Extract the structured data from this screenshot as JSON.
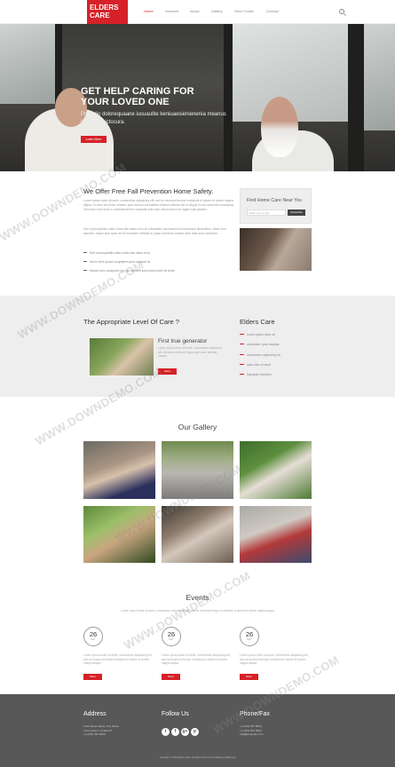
{
  "brand": {
    "line1": "ELDERS",
    "line2": "CARE"
  },
  "nav": {
    "items": [
      "Home",
      "Services",
      "About",
      "Gallery",
      "Short Codes",
      "Contact"
    ],
    "active_index": 0
  },
  "hero": {
    "title_line1": "GET HELP CARING FOR",
    "title_line2": "YOUR LOVED ONE",
    "subtitle": "Pro odio dolorequaane iusuaulite keniuaesienienenia meanus tincidunt pictocura.",
    "button": "Learn More"
  },
  "prevention": {
    "title": "We Offer Free Fall Prevention Home Safety.",
    "para1": "Lorem ipsum dolor sit amet, consectetur adipiscing elit, sed do eiusmod tempor incididunt ut labore et dolore magna aliqua. Ut enim ad minim veniam, quis nostrud exercitation ullamco laboris nisi ut aliquip ex ea commodo consequat. Duis aute irure dolor in reprehenderit in voluptate velit esse cillum dolore eu fugiat nulla pariatur.",
    "para2": "Sed ut perspiciatis unde omnis iste natus error sit voluptatem accusantium doloremque laudantium, totam rem aperiam, eaque ipsa quae ab illo inventore veritatis et quasi architecto beatae vitae dicta sunt explicabo.",
    "list": [
      "Sed ut perspiciatis unde omnis iste natus error",
      "Nemo enim ipsam voluptatem quia voluptas sit",
      "Neque porro quisquam est, qui dolorem ipsum quia dolor sit amet"
    ]
  },
  "form": {
    "title": "Find Home Care Near You",
    "placeholder": "Enter your email",
    "button": "Subscribe"
  },
  "care": {
    "title": "The Appropriate Level Of Care ?",
    "feature_title": "First true generator",
    "feature_text": "Lorem ipsum dolor sit amet, consectetur adipiscing elit. Aenean commodo ligula eget dolor aenean massa.",
    "button": "More"
  },
  "elders": {
    "title": "Elders Care",
    "items": [
      "Lorem ipsum dolor sit",
      "voluptatem quia voluptas",
      "consectetur adipiscing elit",
      "quia dolor sit amet",
      "Dignissim tincidunt"
    ]
  },
  "gallery": {
    "title": "Our Gallery"
  },
  "events": {
    "title": "Events",
    "subtitle": "Lorem ipsum dolor sit amet, consectetur adipiscing elit, sed do eiusmod tempor incididunt ut labore et dolore magna aliqua.",
    "items": [
      {
        "day": "26",
        "month": "MAY",
        "text": "Lorem ipsum dolor sit amet, consectetur adipiscing elit, sed do eiusmod tempor incididunt ut labore et dolore magna aliqua.",
        "button": "More"
      },
      {
        "day": "26",
        "month": "MAY",
        "text": "Lorem ipsum dolor sit amet, consectetur adipiscing elit, sed do eiusmod tempor incididunt ut labore et dolore magna aliqua.",
        "button": "More"
      },
      {
        "day": "26",
        "month": "MAY",
        "text": "Lorem ipsum dolor sit amet, consectetur adipiscing elit, sed do eiusmod tempor incididunt ut labore et dolore magna aliqua.",
        "button": "More"
      }
    ]
  },
  "footer": {
    "address_title": "Address",
    "address_lines": [
      "1234 Street Name, City Name",
      "Lorem Ipsum, United KT",
      "+1 (234) 567 8910"
    ],
    "follow_title": "Follow Us",
    "socials": [
      "t",
      "f",
      "g+",
      "p"
    ],
    "phone_title": "Phone/Fax",
    "phone_lines": [
      "+1 (234) 567 8910",
      "+1 (234) 567 8910",
      "mail@example.com"
    ],
    "copyright": "Copyright © 2016 Elders Care. All rights reserved | Template by W3layouts"
  },
  "watermark": "WWW.DOWNDEMO.COM",
  "colors": {
    "accent": "#d62128",
    "footer": "#585858",
    "band": "#eeeeee"
  }
}
